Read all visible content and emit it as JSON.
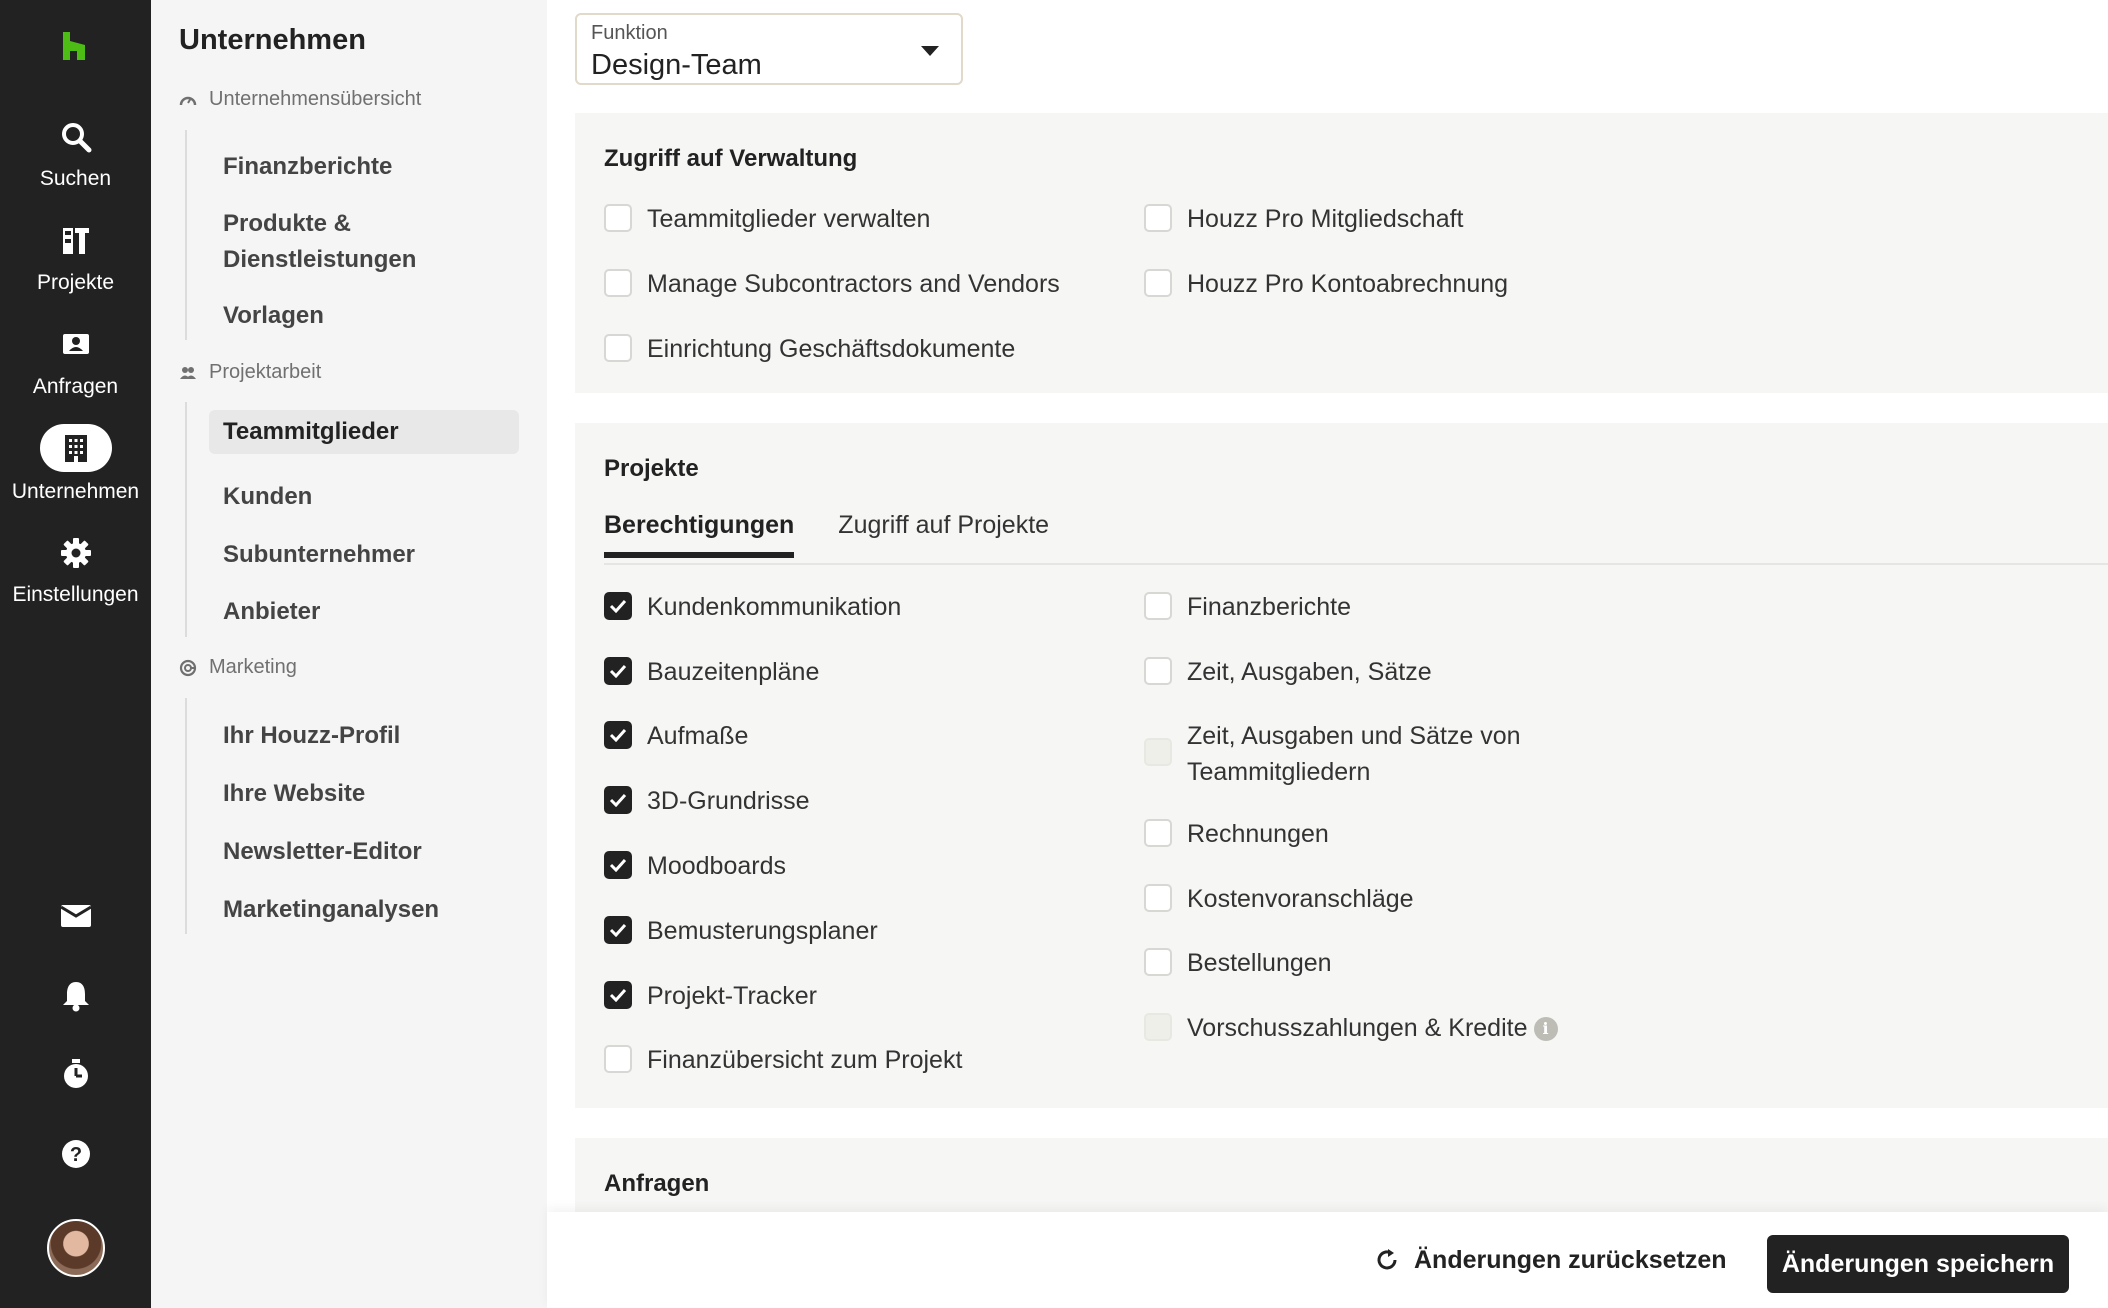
{
  "rail": {
    "items": [
      {
        "label": "Suchen",
        "icon": "search-icon"
      },
      {
        "label": "Projekte",
        "icon": "projects-icon"
      },
      {
        "label": "Anfragen",
        "icon": "inquiries-icon"
      },
      {
        "label": "Unternehmen",
        "icon": "company-icon",
        "active": true
      },
      {
        "label": "Einstellungen",
        "icon": "gear-icon"
      }
    ],
    "bottom_icons": [
      "mail-icon",
      "bell-icon",
      "timer-icon",
      "help-icon",
      "avatar"
    ]
  },
  "subnav": {
    "title": "Unternehmen",
    "sections": [
      {
        "heading": "Unternehmensübersicht",
        "items": [
          "Finanzberichte",
          "Produkte & Dienstleistungen",
          "Vorlagen"
        ]
      },
      {
        "heading": "Projektarbeit",
        "items": [
          "Teammitglieder",
          "Kunden",
          "Subunternehmer",
          "Anbieter"
        ],
        "active": "Teammitglieder"
      },
      {
        "heading": "Marketing",
        "items": [
          "Ihr Houzz-Profil",
          "Ihre Website",
          "Newsletter-Editor",
          "Marketinganalysen"
        ]
      }
    ]
  },
  "role_select": {
    "caption": "Funktion",
    "value": "Design-Team"
  },
  "admin_access": {
    "title": "Zugriff auf Verwaltung",
    "options": [
      {
        "label": "Teammitglieder verwalten",
        "checked": false
      },
      {
        "label": "Manage Subcontractors and Vendors",
        "checked": false
      },
      {
        "label": "Einrichtung Geschäftsdokumente",
        "checked": false
      },
      {
        "label": "Houzz Pro Mitgliedschaft",
        "checked": false
      },
      {
        "label": "Houzz Pro Kontoabrechnung",
        "checked": false
      }
    ]
  },
  "projects": {
    "title": "Projekte",
    "tabs": [
      {
        "label": "Berechtigungen",
        "active": true
      },
      {
        "label": "Zugriff auf Projekte",
        "active": false
      }
    ],
    "left": [
      {
        "label": "Kundenkommunikation",
        "checked": true
      },
      {
        "label": "Bauzeitenpläne",
        "checked": true
      },
      {
        "label": "Aufmaße",
        "checked": true
      },
      {
        "label": "3D-Grundrisse",
        "checked": true
      },
      {
        "label": "Moodboards",
        "checked": true
      },
      {
        "label": "Bemusterungsplaner",
        "checked": true
      },
      {
        "label": "Projekt-Tracker",
        "checked": true
      },
      {
        "label": "Finanzübersicht zum Projekt",
        "checked": false
      }
    ],
    "right": [
      {
        "label": "Finanzberichte",
        "checked": false
      },
      {
        "label": "Zeit, Ausgaben, Sätze",
        "checked": false
      },
      {
        "label": "Zeit, Ausgaben und Sätze von Teammitgliedern",
        "checked": false,
        "disabled": true
      },
      {
        "label": "Rechnungen",
        "checked": false
      },
      {
        "label": "Kostenvoranschläge",
        "checked": false
      },
      {
        "label": "Bestellungen",
        "checked": false
      },
      {
        "label": "Vorschusszahlungen & Kredite",
        "checked": false,
        "disabled": true,
        "info": true
      }
    ]
  },
  "inquiries": {
    "title": "Anfragen"
  },
  "footer": {
    "reset_label": "Änderungen zurücksetzen",
    "save_label": "Änderungen speichern"
  },
  "colors": {
    "rail_bg": "#222222",
    "accent_green": "#4dbc15",
    "subnav_bg": "#f5f5f5",
    "card_bg": "#f6f6f5"
  }
}
